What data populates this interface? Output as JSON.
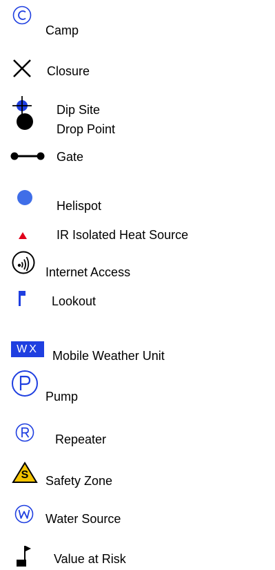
{
  "legend": {
    "items": [
      {
        "label": "Camp",
        "icon": "camp-circled-c-icon"
      },
      {
        "label": "Closure",
        "icon": "closure-x-icon"
      },
      {
        "label": "Dip Site",
        "icon": "dip-site-crosshair-icon"
      },
      {
        "label": "Drop Point",
        "icon": "drop-point-dot-icon"
      },
      {
        "label": "Gate",
        "icon": "gate-bar-icon"
      },
      {
        "label": "Helispot",
        "icon": "helispot-dot-icon"
      },
      {
        "label": "IR Isolated Heat Source",
        "icon": "heat-source-triangle-icon"
      },
      {
        "label": "Internet Access",
        "icon": "internet-access-icon"
      },
      {
        "label": "Lookout",
        "icon": "lookout-flag-icon"
      },
      {
        "label": "Mobile Weather Unit",
        "icon": "weather-unit-wx-icon"
      },
      {
        "label": "Pump",
        "icon": "pump-circled-p-icon"
      },
      {
        "label": "Repeater",
        "icon": "repeater-circled-r-icon"
      },
      {
        "label": "Safety Zone",
        "icon": "safety-zone-triangle-icon"
      },
      {
        "label": "Water Source",
        "icon": "water-source-circled-w-icon"
      },
      {
        "label": "Value at Risk",
        "icon": "value-at-risk-flag-icon"
      }
    ],
    "glyphs": {
      "wx": "WX",
      "s": "S"
    },
    "colors": {
      "blue": "#1f3fe0",
      "helispot": "#3f6ee8",
      "red": "#e0001b",
      "yellow": "#f4c300",
      "black": "#000000"
    }
  }
}
